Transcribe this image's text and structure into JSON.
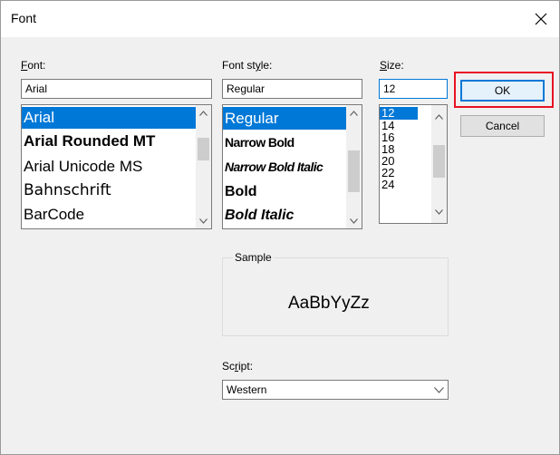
{
  "window": {
    "title": "Font",
    "close_glyph": "✕"
  },
  "font": {
    "label_prefix": "",
    "label_u": "F",
    "label_rest": "ont:",
    "value": "Arial",
    "items": [
      "Arial",
      "Arial Rounded MT",
      "Arial Unicode MS",
      "Bahnschrift",
      "BarCode"
    ]
  },
  "style": {
    "label_prefix": "Font st",
    "label_u": "y",
    "label_rest": "le:",
    "value": "Regular",
    "items": [
      "Regular",
      "Narrow Bold",
      "Narrow Bold Italic",
      "Bold",
      "Bold Italic"
    ]
  },
  "size": {
    "label_prefix": "",
    "label_u": "S",
    "label_rest": "ize:",
    "value": "12",
    "items": [
      "12",
      "14",
      "16",
      "18",
      "20",
      "22",
      "24"
    ]
  },
  "buttons": {
    "ok": "OK",
    "cancel": "Cancel"
  },
  "sample": {
    "label": "Sample",
    "text": "AaBbYyZz"
  },
  "script": {
    "label_prefix": "Sc",
    "label_u": "r",
    "label_rest": "ipt:",
    "value": "Western"
  },
  "icons": {
    "scroll_up": "⌃",
    "scroll_down": "⌄",
    "dropdown": "⌵"
  },
  "colors": {
    "selection": "#0078d7",
    "highlight_border": "#e81123"
  }
}
